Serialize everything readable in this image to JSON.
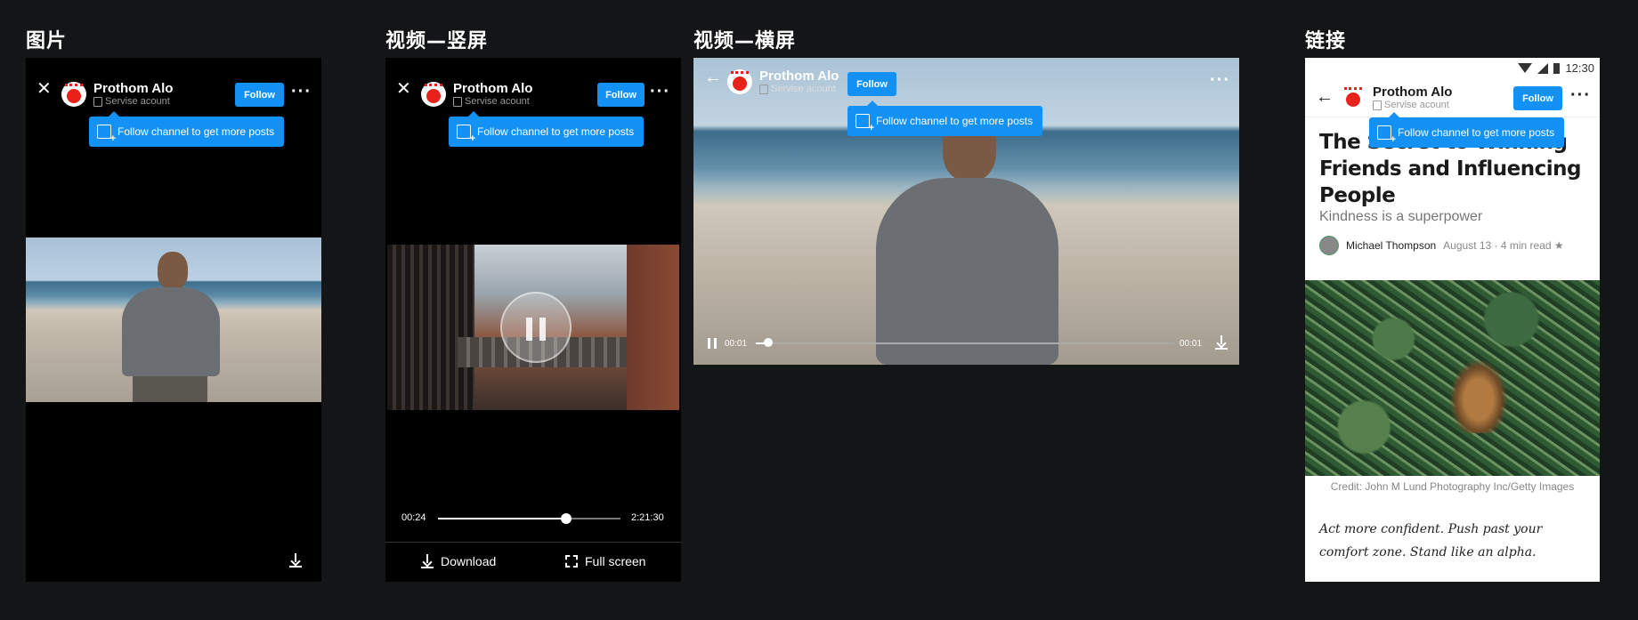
{
  "sections": {
    "image": "图片",
    "video_portrait": "视频—竖屏",
    "video_landscape": "视频—横屏",
    "link": "链接"
  },
  "account": {
    "name": "Prothom Alo",
    "subtitle": "Servise acount",
    "follow": "Follow",
    "tooltip": "Follow channel to get more posts"
  },
  "video_portrait": {
    "current_time": "00:24",
    "duration": "2:21:30",
    "progress": 0.7,
    "download": "Download",
    "fullscreen": "Full screen"
  },
  "video_landscape": {
    "current_time": "00:01",
    "duration": "00:01",
    "progress": 0.03
  },
  "article": {
    "status_time": "12:30",
    "title": "The Secret to Winning Friends and Influencing People",
    "subtitle": "Kindness is a superpower",
    "author": "Michael Thompson",
    "meta": "August 13 · 4 min read ★",
    "credit": "Credit: John M Lund Photography Inc/Getty Images",
    "quote": "Act more confident. Push past your comfort zone. Stand like an alpha."
  },
  "colors": {
    "accent": "#1491f5",
    "background": "#141517",
    "logo_red": "#e8211b"
  }
}
